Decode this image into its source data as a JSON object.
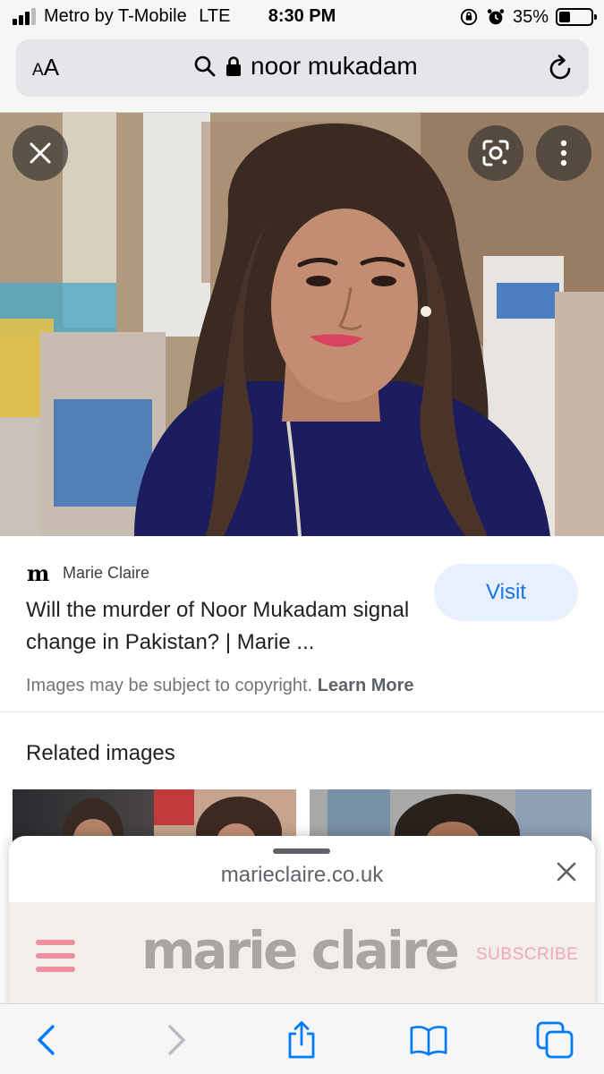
{
  "status_bar": {
    "carrier": "Metro by T-Mobile",
    "network": "LTE",
    "time": "8:30 PM",
    "battery_percent": "35%",
    "battery_level": 0.35,
    "icons": [
      "signal-icon",
      "orientation-lock-icon",
      "alarm-icon",
      "battery-icon"
    ]
  },
  "address_bar": {
    "text_size_button": "AA",
    "query": "noor mukadam",
    "icons": [
      "search-icon",
      "lock-icon",
      "reload-icon"
    ]
  },
  "image_viewer": {
    "buttons": [
      "close-icon",
      "lens-icon",
      "more-vert-icon"
    ]
  },
  "result": {
    "source_logo": "m",
    "source_name": "Marie Claire",
    "title": "Will the murder of Noor Mukadam signal change in Pakistan? | Marie ...",
    "visit_label": "Visit",
    "copyright_text": "Images may be subject to copyright.",
    "learn_more_label": "Learn More"
  },
  "related": {
    "heading": "Related images"
  },
  "preview_sheet": {
    "domain": "marieclaire.co.uk",
    "site_logo_text": "marie claire",
    "subscribe_label": "SUBSCRIBE"
  },
  "bottom_toolbar": {
    "buttons": [
      "back-icon",
      "forward-icon",
      "share-icon",
      "bookmarks-icon",
      "tabs-icon"
    ]
  },
  "colors": {
    "accent": "#1a73e8",
    "visit_bg": "#e8f0fe",
    "ios_blue": "#007aff",
    "brand_pink": "#ee8fa0"
  }
}
